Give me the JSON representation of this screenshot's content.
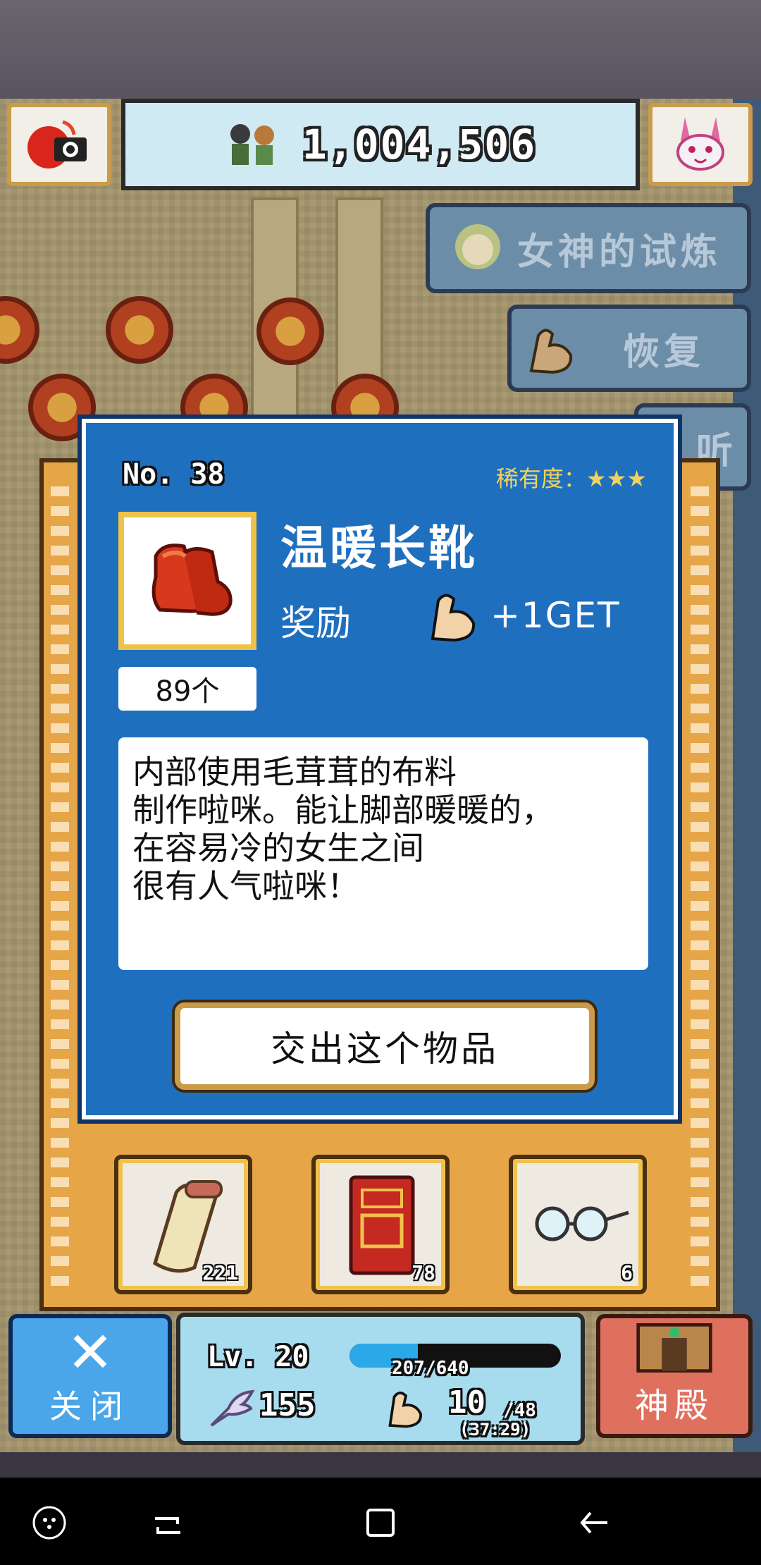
{
  "top_bar": {
    "score": "1,004,506",
    "camera_icon": "camera-icon",
    "bunny_icon": "bunny-mascot-icon"
  },
  "side_menu": {
    "goddess_trial": "女神的试炼",
    "recover": "恢复",
    "partial_label": "听"
  },
  "item": {
    "number": "No. 38",
    "rarity": "稀有度：★★★",
    "name": "温暖长靴",
    "count": "89个",
    "reward_label": "奖励",
    "reward_value": "+1GET",
    "description": "内部使用毛茸茸的布料\n制作啦咪。能让脚部暖暖的，\n在容易冷的女生之间\n很有人气啦咪！",
    "deliver_button": "交出这个物品"
  },
  "inventory": [
    {
      "name": "scroll-icon",
      "count": "221"
    },
    {
      "name": "red-book-icon",
      "count": "78"
    },
    {
      "name": "glasses-icon",
      "count": "6"
    }
  ],
  "bottom_bar": {
    "close_label": "关闭",
    "level": "Lv. 20",
    "xp": "207/640",
    "xp_fraction": 0.323,
    "stat1": "155",
    "stat2": "10",
    "stat2_max": "/48",
    "stat2_time": "(37:29)",
    "temple_label": "神殿"
  },
  "colors": {
    "dialog_blue": "#1f6fbf",
    "frame_orange": "#e6a547",
    "rarity_gold": "#f2d35a",
    "close_blue": "#4aa6e8",
    "temple_red": "#e0705e"
  }
}
